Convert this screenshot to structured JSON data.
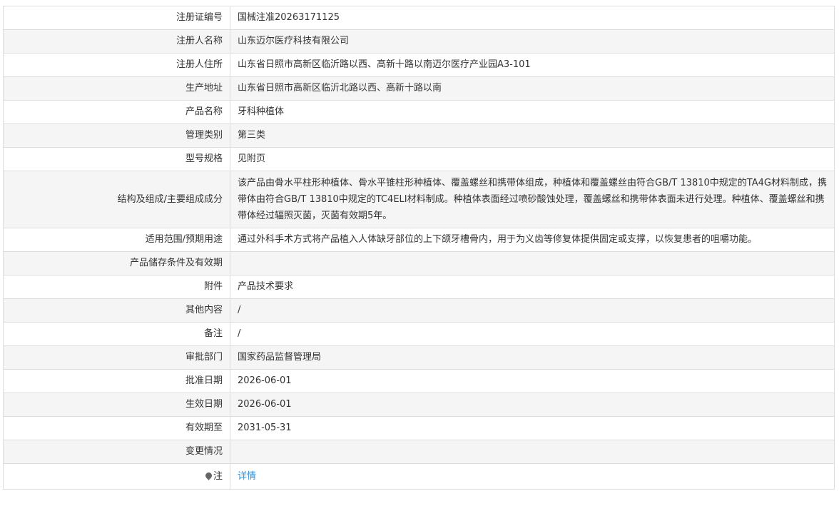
{
  "record": {
    "rows": [
      {
        "label": "注册证编号",
        "value": "国械注准20263171125"
      },
      {
        "label": "注册人名称",
        "value": "山东迈尔医疗科技有限公司"
      },
      {
        "label": "注册人住所",
        "value": "山东省日照市高新区临沂路以西、高新十路以南迈尔医疗产业园A3-101"
      },
      {
        "label": "生产地址",
        "value": "山东省日照市高新区临沂北路以西、高新十路以南"
      },
      {
        "label": "产品名称",
        "value": "牙科种植体"
      },
      {
        "label": "管理类别",
        "value": "第三类"
      },
      {
        "label": "型号规格",
        "value": "见附页"
      },
      {
        "label": "结构及组成/主要组成成分",
        "value": "该产品由骨水平柱形种植体、骨水平锥柱形种植体、覆盖螺丝和携带体组成，种植体和覆盖螺丝由符合GB/T 13810中规定的TA4G材料制成，携带体由符合GB/T 13810中规定的TC4ELI材料制成。种植体表面经过喷砂酸蚀处理，覆盖螺丝和携带体表面未进行处理。种植体、覆盖螺丝和携带体经过辐照灭菌，灭菌有效期5年。"
      },
      {
        "label": "适用范围/预期用途",
        "value": "通过外科手术方式将产品植入人体缺牙部位的上下颌牙槽骨内，用于为义齿等修复体提供固定或支撑，以恢复患者的咀嚼功能。"
      },
      {
        "label": "产品储存条件及有效期",
        "value": ""
      },
      {
        "label": "附件",
        "value": "产品技术要求"
      },
      {
        "label": "其他内容",
        "value": "/"
      },
      {
        "label": "备注",
        "value": "/"
      },
      {
        "label": "审批部门",
        "value": "国家药品监督管理局"
      },
      {
        "label": "批准日期",
        "value": "2026-06-01"
      },
      {
        "label": "生效日期",
        "value": "2026-06-01"
      },
      {
        "label": "有效期至",
        "value": "2031-05-31"
      },
      {
        "label": "变更情况",
        "value": ""
      }
    ],
    "note": {
      "icon": "pin-icon",
      "label": "注",
      "link_text": "详情"
    }
  }
}
